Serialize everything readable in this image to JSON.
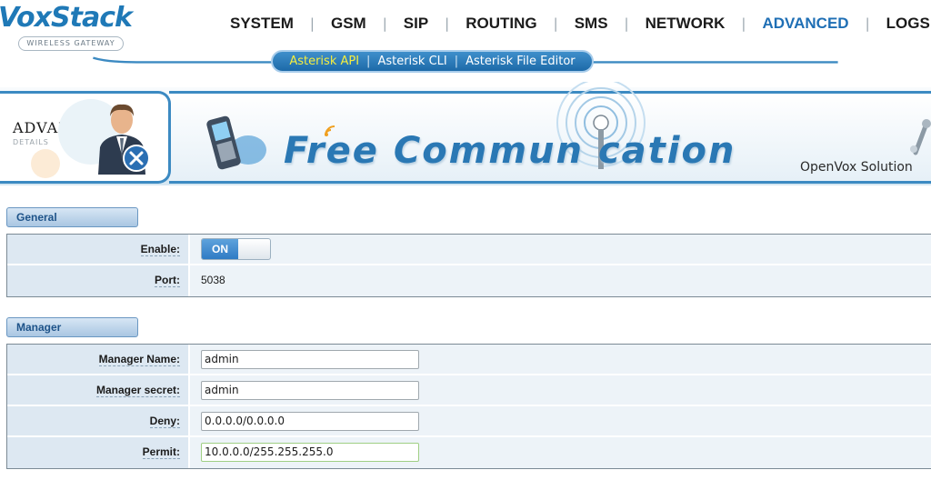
{
  "brand": {
    "name": "VoxStack",
    "tagline": "WIRELESS GATEWAY"
  },
  "topnav": {
    "items": [
      {
        "label": "SYSTEM"
      },
      {
        "label": "GSM"
      },
      {
        "label": "SIP"
      },
      {
        "label": "ROUTING"
      },
      {
        "label": "SMS"
      },
      {
        "label": "NETWORK"
      },
      {
        "label": "ADVANCED",
        "active": true
      },
      {
        "label": "LOGS"
      }
    ]
  },
  "subnav": {
    "items": [
      {
        "label": "Asterisk API",
        "active": true
      },
      {
        "label": "Asterisk CLI"
      },
      {
        "label": "Asterisk File Editor"
      }
    ]
  },
  "banner": {
    "section_title": "ADVANCED",
    "section_sub": "DETAILS",
    "slogan": "Free Commun  cation",
    "company": "OpenVox Solution"
  },
  "general": {
    "title": "General",
    "enable_label": "Enable:",
    "enable_state": "ON",
    "port_label": "Port:",
    "port_value": "5038"
  },
  "manager": {
    "title": "Manager",
    "name_label": "Manager Name:",
    "name_value": "admin",
    "secret_label": "Manager secret:",
    "secret_value": "admin",
    "deny_label": "Deny:",
    "deny_value": "0.0.0.0/0.0.0.0",
    "permit_label": "Permit:",
    "permit_value": "10.0.0.0/255.255.255.0"
  },
  "colors": {
    "accent": "#1f6fb5",
    "subnav_active": "#f6ee3f",
    "header_blue": "#3c8ac2"
  }
}
